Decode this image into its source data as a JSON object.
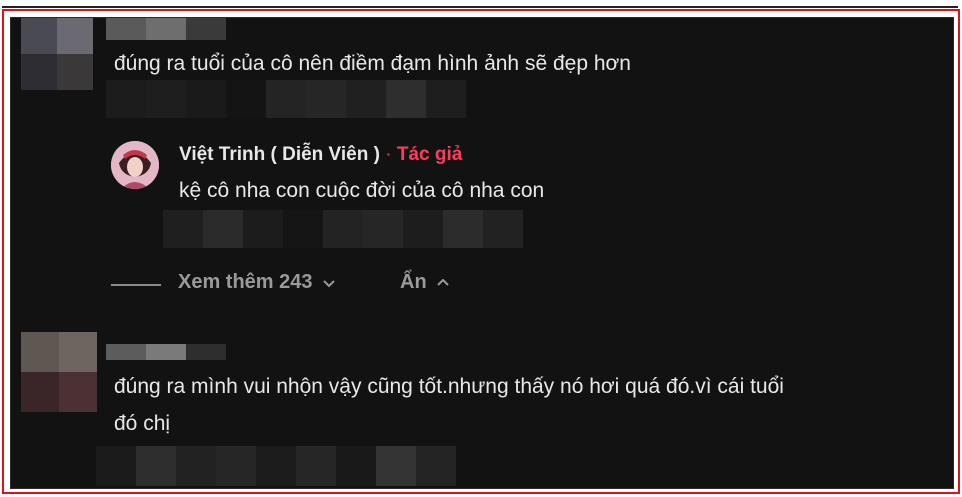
{
  "comments": [
    {
      "text": "đúng ra tuổi của cô nên điềm đạm hình ảnh sẽ đẹp hơn"
    },
    {
      "text": "đúng ra mình vui nhộn vậy cũng tốt.nhưng thấy nó hơi quá đó.vì cái tuổi",
      "text_line2": "đó chị"
    }
  ],
  "reply": {
    "author": "Việt Trinh ( Diễn Viên )",
    "separator": "·",
    "badge": "Tác giả",
    "text": "kệ cô nha con cuộc đời của cô nha con"
  },
  "thread": {
    "view_more": "Xem thêm 243",
    "hide": "Ẩn"
  },
  "colors": {
    "background": "#121212",
    "text": "#e8e8e8",
    "author_badge": "#ff3b5c",
    "muted": "#9a9a9a",
    "frame": "#d9141c"
  }
}
